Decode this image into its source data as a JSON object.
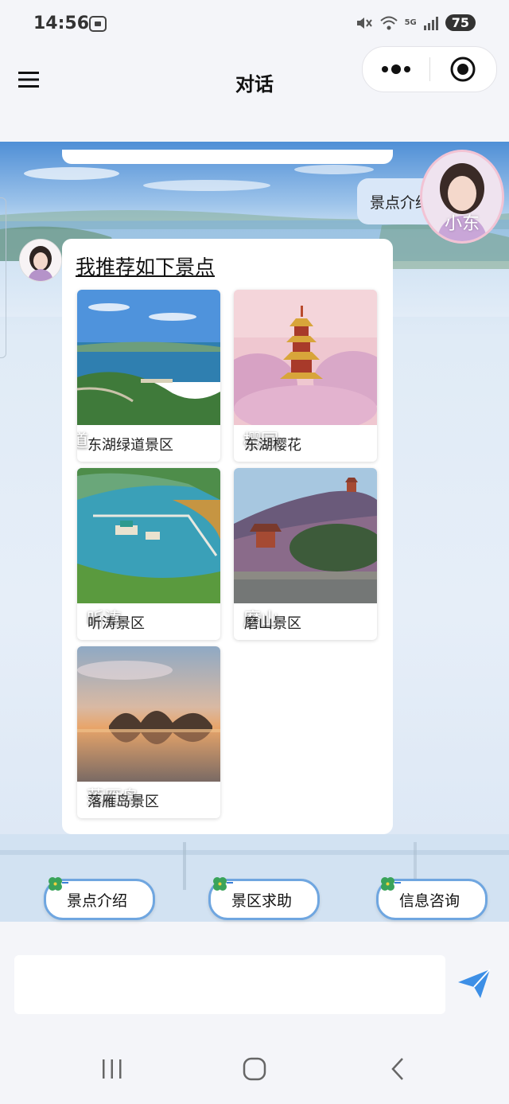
{
  "status_bar": {
    "time": "14:56",
    "battery": "75",
    "network": "5G"
  },
  "header": {
    "title": "对话"
  },
  "user_message": {
    "text": "景点介绍",
    "avatar_name": "小东"
  },
  "bot_message": {
    "title": "我推荐如下景点",
    "spots": [
      {
        "label": "东湖绿道景区",
        "overlay": "道"
      },
      {
        "label": "东湖樱花",
        "overlay": "樱园"
      },
      {
        "label": "听涛景区",
        "overlay": "听涛"
      },
      {
        "label": "磨山景区",
        "overlay": "磨山"
      },
      {
        "label": "落雁岛景区",
        "overlay": "落雁岛"
      }
    ]
  },
  "quick_actions": [
    {
      "label": "景点介绍"
    },
    {
      "label": "景区求助"
    },
    {
      "label": "信息咨询"
    }
  ],
  "input": {
    "placeholder": ""
  },
  "colors": {
    "accent": "#6fa6e0",
    "send": "#3d8fe6"
  }
}
